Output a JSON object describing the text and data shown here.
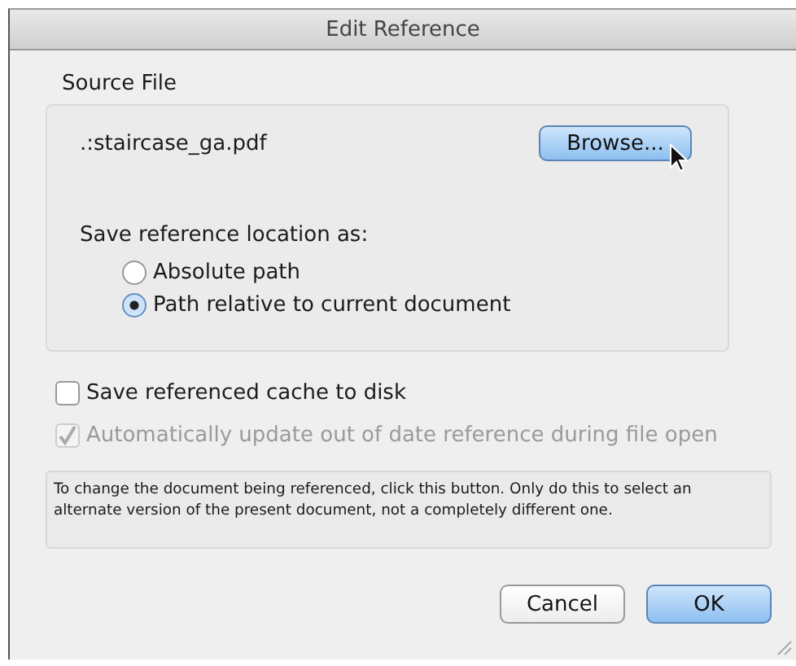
{
  "window": {
    "title": "Edit Reference"
  },
  "source_file": {
    "label": "Source File",
    "path": ".:staircase_ga.pdf",
    "browse_button": "Browse...",
    "location_label": "Save reference location as:",
    "options": [
      {
        "label": "Absolute path",
        "selected": false
      },
      {
        "label": "Path relative to current document",
        "selected": true
      }
    ]
  },
  "checkboxes": [
    {
      "label": "Save referenced cache to disk",
      "checked": false,
      "disabled": false
    },
    {
      "label": "Automatically update out of date reference during file open",
      "checked": true,
      "disabled": true
    }
  ],
  "help_text": "To change the document being referenced, click this button.  Only do this to select an alternate version of the present document, not a completely different one.",
  "buttons": [
    {
      "label": "Cancel",
      "default": false
    },
    {
      "label": "OK",
      "default": true
    }
  ]
}
